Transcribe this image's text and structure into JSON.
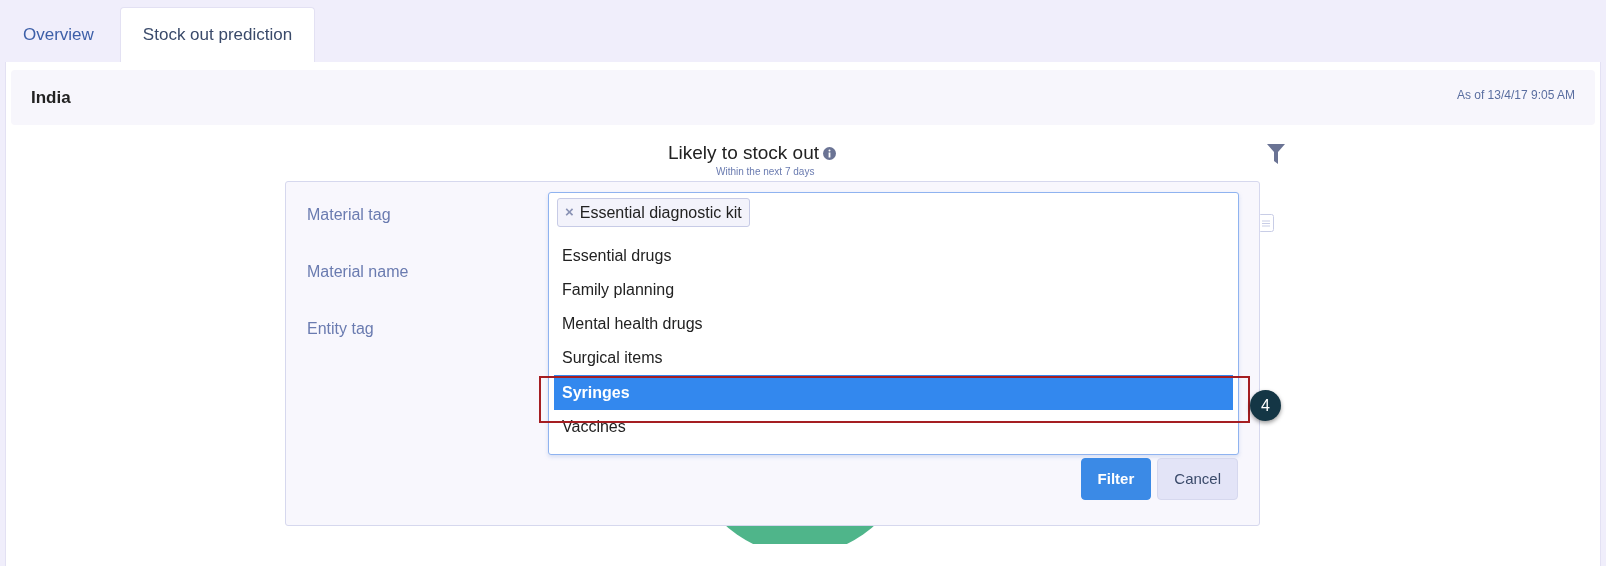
{
  "tabs": [
    {
      "label": "Overview",
      "selected": false
    },
    {
      "label": "Stock out prediction",
      "selected": true
    }
  ],
  "header": {
    "title": "India",
    "timestamp": "As of 13/4/17 9:05 AM"
  },
  "chart": {
    "title": "Likely to stock out",
    "subtitle": "Within the next 7 days"
  },
  "filter_panel": {
    "fields": [
      {
        "label": "Material tag"
      },
      {
        "label": "Material name"
      },
      {
        "label": "Entity tag"
      }
    ],
    "material_tag": {
      "chips": [
        {
          "remove": "×",
          "label": "Essential diagnostic kit"
        }
      ],
      "options": [
        {
          "label": "Essential drugs",
          "selected": false
        },
        {
          "label": "Family planning",
          "selected": false
        },
        {
          "label": "Mental health drugs",
          "selected": false
        },
        {
          "label": "Surgical items",
          "selected": false
        },
        {
          "label": "Syringes",
          "selected": true
        },
        {
          "label": "Vaccines",
          "selected": false
        }
      ]
    },
    "buttons": [
      {
        "label": "Filter",
        "kind": "primary"
      },
      {
        "label": "Cancel",
        "kind": "secondary"
      }
    ]
  },
  "callout": {
    "number": "4"
  }
}
